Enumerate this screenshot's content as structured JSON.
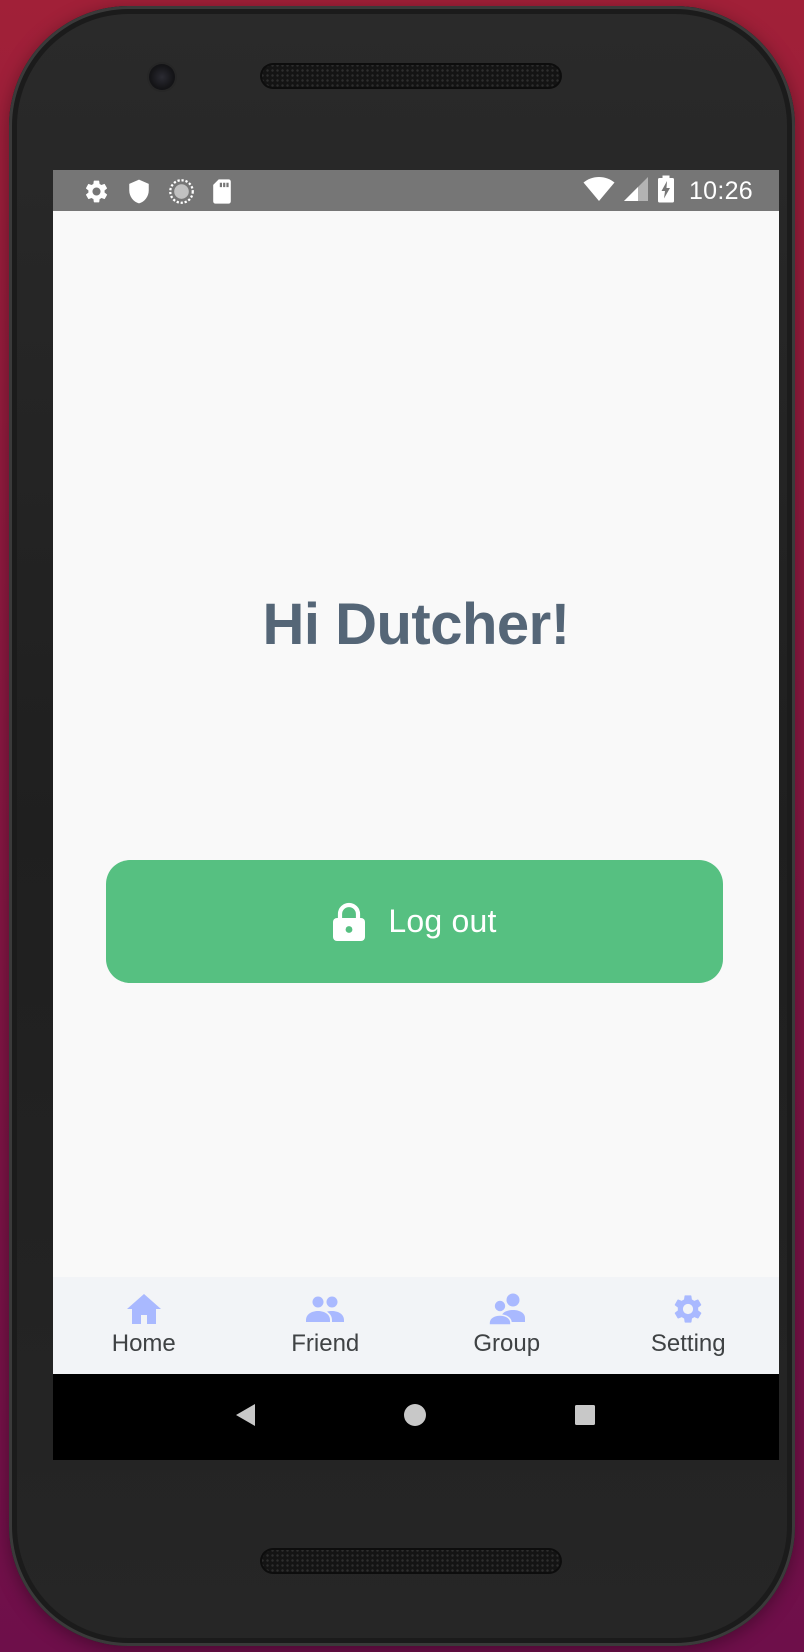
{
  "status_bar": {
    "time": "10:26",
    "left_icons": [
      "gear-icon",
      "shield-icon",
      "sync-circle-icon",
      "sd-card-icon"
    ],
    "right_icons": [
      "wifi-icon",
      "cell-signal-icon",
      "battery-charging-icon"
    ]
  },
  "main": {
    "greeting": "Hi Dutcher!",
    "logout_button": {
      "label": "Log out",
      "icon": "lock-icon",
      "color": "#56c081"
    }
  },
  "tab_bar": {
    "items": [
      {
        "label": "Home",
        "icon": "home-icon"
      },
      {
        "label": "Friend",
        "icon": "friends-icon"
      },
      {
        "label": "Group",
        "icon": "group-chat-icon"
      },
      {
        "label": "Setting",
        "icon": "gear-icon"
      }
    ],
    "icon_color": "#a9b9ff"
  },
  "nav_bar": {
    "buttons": [
      "back-triangle-icon",
      "home-circle-icon",
      "recents-square-icon"
    ]
  }
}
